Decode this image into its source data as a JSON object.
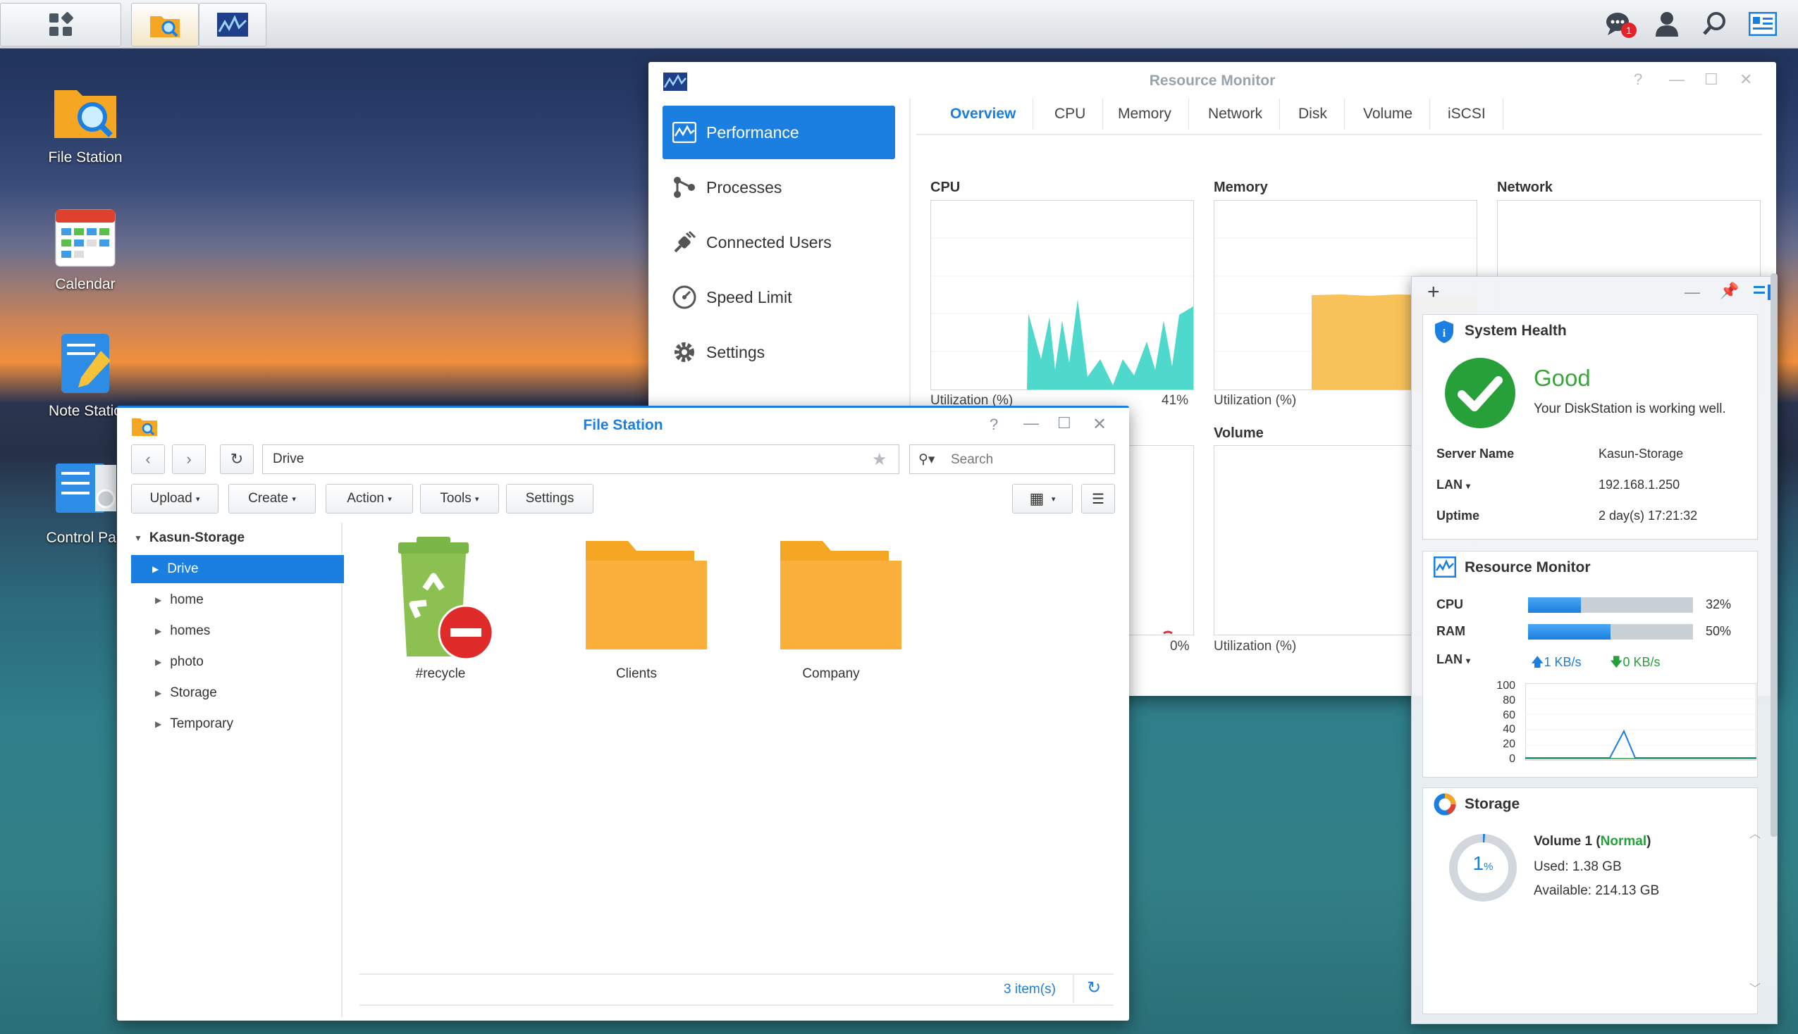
{
  "taskbar": {
    "notification_count": "1"
  },
  "desktop": {
    "icons": [
      {
        "label": "File Station"
      },
      {
        "label": "Calendar"
      },
      {
        "label": "Note Statio"
      },
      {
        "label": "Control Pan"
      }
    ]
  },
  "resource_monitor": {
    "title": "Resource Monitor",
    "sidebar": [
      {
        "label": "Performance"
      },
      {
        "label": "Processes"
      },
      {
        "label": "Connected Users"
      },
      {
        "label": "Speed Limit"
      },
      {
        "label": "Settings"
      }
    ],
    "tabs": [
      "Overview",
      "CPU",
      "Memory",
      "Network",
      "Disk",
      "Volume",
      "iSCSI"
    ],
    "panels": {
      "cpu": {
        "label": "CPU",
        "util_label": "Utilization (%)",
        "value": "41%"
      },
      "memory": {
        "label": "Memory",
        "util_label": "Utilization (%)"
      },
      "network": {
        "label": "Network"
      },
      "disk": {
        "value": "0%"
      },
      "volume": {
        "label": "Volume",
        "util_label": "Utilization (%)"
      }
    }
  },
  "widgets": {
    "system_health": {
      "title": "System Health",
      "status": "Good",
      "message": "Your DiskStation is working well.",
      "server_name_label": "Server Name",
      "server_name": "Kasun-Storage",
      "lan_label": "LAN",
      "lan_ip": "192.168.1.250",
      "uptime_label": "Uptime",
      "uptime": "2 day(s) 17:21:32"
    },
    "resource_monitor": {
      "title": "Resource Monitor",
      "cpu_label": "CPU",
      "cpu_value": "32%",
      "cpu_fraction": 0.32,
      "ram_label": "RAM",
      "ram_value": "50%",
      "ram_fraction": 0.5,
      "lan_label": "LAN",
      "upload": "1 KB/s",
      "download": "0 KB/s",
      "chart_ticks": [
        "100",
        "80",
        "60",
        "40",
        "20",
        "0"
      ]
    },
    "storage": {
      "title": "Storage",
      "volume_name": "Volume 1",
      "volume_status": "Normal",
      "used": "Used: 1.38 GB",
      "available": "Available: 214.13 GB",
      "percent": "1",
      "percent_unit": "%"
    }
  },
  "file_station": {
    "title": "File Station",
    "path": "Drive",
    "search_placeholder": "Search",
    "toolbar": {
      "upload": "Upload",
      "create": "Create",
      "action": "Action",
      "tools": "Tools",
      "settings": "Settings"
    },
    "tree_root": "Kasun-Storage",
    "tree": [
      "Drive",
      "home",
      "homes",
      "photo",
      "Storage",
      "Temporary"
    ],
    "files": [
      {
        "name": "#recycle"
      },
      {
        "name": "Clients"
      },
      {
        "name": "Company"
      }
    ],
    "item_count": "3 item(s)"
  },
  "colors": {
    "accent": "#1a7fe0",
    "good_green": "#3ba53b",
    "folder": "#f5a623",
    "cpu_fill": "#4fd8cc",
    "mem_fill": "#f7c25a"
  }
}
